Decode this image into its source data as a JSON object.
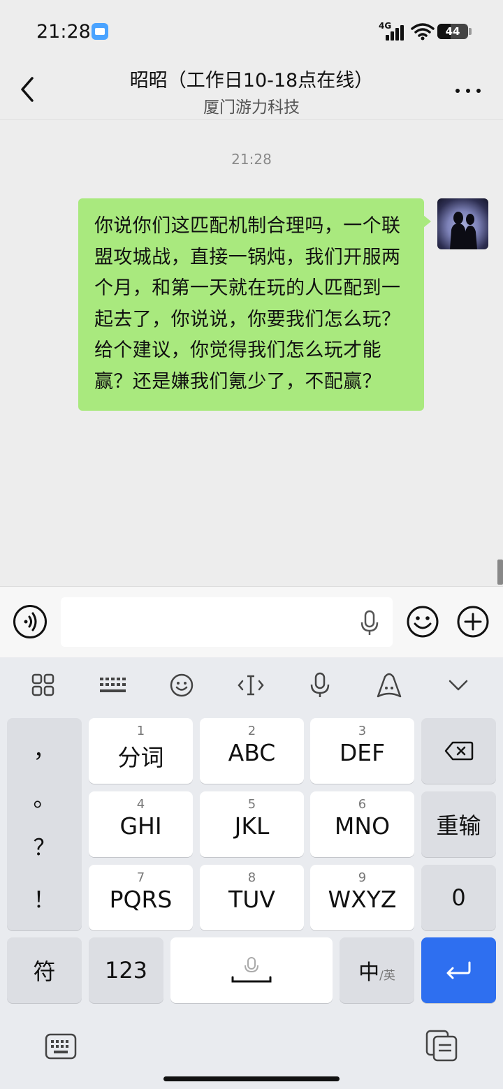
{
  "status_bar": {
    "time": "21:28",
    "network": "4G",
    "battery_level": "44",
    "battery_fraction": 0.44
  },
  "header": {
    "title": "昭昭（工作日10-18点在线）",
    "subtitle": "厦门游力科技"
  },
  "chat": {
    "timestamp": "21:28",
    "messages": [
      {
        "sender": "self",
        "text": "你说你们这匹配机制合理吗，一个联盟攻城战，直接一锅炖，我们开服两个月，和第一天就在玩的人匹配到一起去了，你说说，你要我们怎么玩？给个建议，你觉得我们怎么玩才能赢？还是嫌我们氪少了，不配赢？"
      }
    ]
  },
  "input_bar": {
    "value": "",
    "placeholder": ""
  },
  "keyboard": {
    "toolbar": [
      "grid-icon",
      "keyboard-icon",
      "emoji-icon",
      "cursor-icon",
      "mic-icon",
      "ai-icon",
      "collapse-icon"
    ],
    "punctuation": [
      "，",
      "。",
      "？",
      "！"
    ],
    "keys": [
      {
        "num": "1",
        "label": "分词"
      },
      {
        "num": "2",
        "label": "ABC"
      },
      {
        "num": "3",
        "label": "DEF"
      },
      {
        "num": "4",
        "label": "GHI"
      },
      {
        "num": "5",
        "label": "JKL"
      },
      {
        "num": "6",
        "label": "MNO"
      },
      {
        "num": "7",
        "label": "PQRS"
      },
      {
        "num": "8",
        "label": "TUV"
      },
      {
        "num": "9",
        "label": "WXYZ"
      }
    ],
    "reinput_label": "重输",
    "zero_label": "0",
    "symbol_label": "符",
    "num_label": "123",
    "lang_main": "中",
    "lang_sub": "/英"
  },
  "colors": {
    "bubble": "#a9e97e",
    "enter_key": "#2e6ff0"
  }
}
